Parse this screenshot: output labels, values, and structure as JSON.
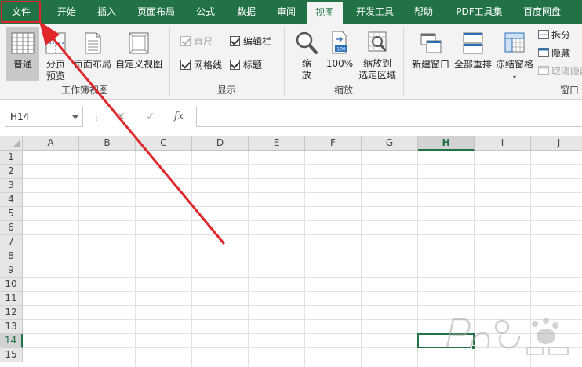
{
  "ribbon_tabs": [
    {
      "label": "文件",
      "active": false
    },
    {
      "label": "开始",
      "active": false
    },
    {
      "label": "插入",
      "active": false
    },
    {
      "label": "页面布局",
      "active": false
    },
    {
      "label": "公式",
      "active": false
    },
    {
      "label": "数据",
      "active": false
    },
    {
      "label": "审阅",
      "active": false
    },
    {
      "label": "视图",
      "active": true
    },
    {
      "label": "开发工具",
      "active": false
    },
    {
      "label": "帮助",
      "active": false
    },
    {
      "label": "PDF工具集",
      "active": false
    },
    {
      "label": "百度网盘",
      "active": false
    }
  ],
  "groups": {
    "workbook_views": {
      "label": "工作簿视图",
      "normal": "普通",
      "page_break_line1": "分页",
      "page_break_line2": "预览",
      "page_layout": "页面布局",
      "custom_views": "自定义视图"
    },
    "show": {
      "label": "显示",
      "ruler": "直尺",
      "formula_bar": "编辑栏",
      "gridlines": "网格线",
      "headings": "标题"
    },
    "zoom": {
      "label": "缩放",
      "zoom_line1": "缩",
      "zoom_line2": "放",
      "zoom_100": "100%",
      "zoom_sel_line1": "缩放到",
      "zoom_sel_line2": "选定区域",
      "badge_100": "100"
    },
    "window": {
      "label": "窗口",
      "new_window": "新建窗口",
      "arrange_all": "全部重排",
      "freeze_panes": "冻结窗格",
      "split": "拆分",
      "hide": "隐藏",
      "unhide": "取消隐藏"
    }
  },
  "formula_bar": {
    "name_box": "H14",
    "dots": "⋮",
    "cancel": "✕",
    "enter": "✓",
    "fx": "fx"
  },
  "sheet": {
    "columns": [
      "A",
      "B",
      "C",
      "D",
      "E",
      "F",
      "G",
      "H",
      "I",
      "J"
    ],
    "rows": [
      "1",
      "2",
      "3",
      "4",
      "5",
      "6",
      "7",
      "8",
      "9",
      "10",
      "11",
      "12",
      "13",
      "14",
      "15"
    ],
    "selected_column": "H",
    "selected_row": "14"
  },
  "colors": {
    "excel_green": "#217346",
    "annotation_red": "#e0262a"
  }
}
